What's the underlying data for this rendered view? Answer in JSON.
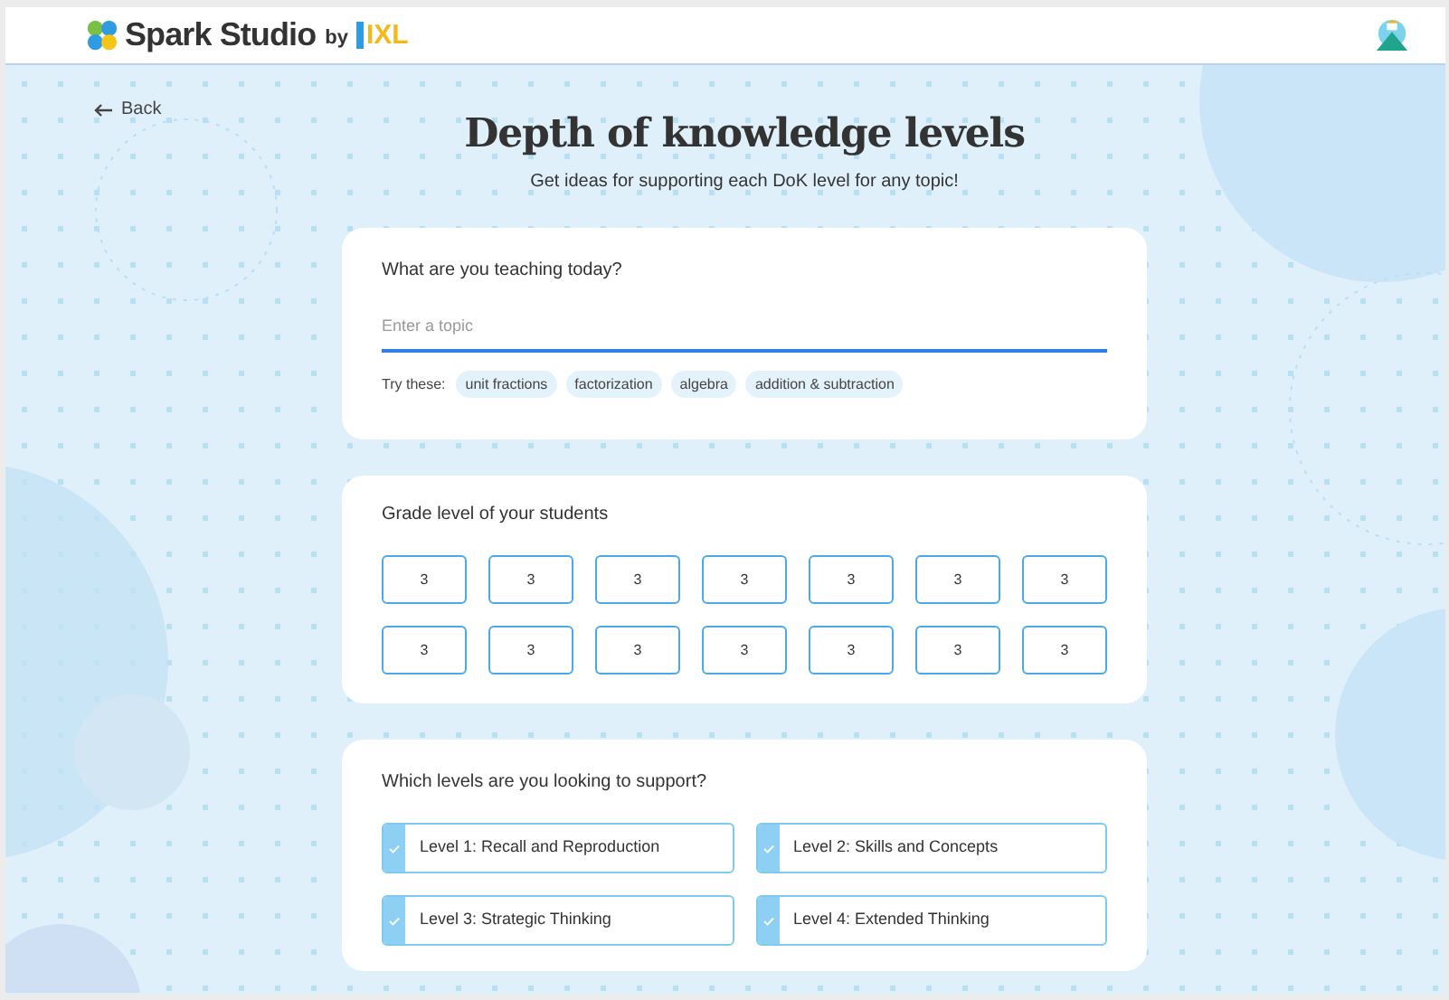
{
  "header": {
    "brand": "Spark Studio",
    "by": "by",
    "partner": "IXL"
  },
  "back": "Back",
  "title": "Depth of knowledge levels",
  "subtitle": "Get ideas for supporting each DoK level for any topic!",
  "topic": {
    "question": "What are you teaching today?",
    "placeholder": "Enter a topic",
    "try_label": "Try these:",
    "suggestions": [
      "unit fractions",
      "factorization",
      "algebra",
      "addition & subtraction"
    ]
  },
  "grade": {
    "question": "Grade level of your students",
    "options": [
      {
        "label": "3",
        "selected": false
      },
      {
        "label": "3",
        "selected": false
      },
      {
        "label": "3",
        "selected": false
      },
      {
        "label": "3",
        "selected": false
      },
      {
        "label": "3",
        "selected": false
      },
      {
        "label": "3",
        "selected": false
      },
      {
        "label": "3",
        "selected": false
      },
      {
        "label": "3",
        "selected": false
      },
      {
        "label": "3",
        "selected": false
      },
      {
        "label": "3",
        "selected": false
      },
      {
        "label": "3",
        "selected": false
      },
      {
        "label": "3",
        "selected": false
      },
      {
        "label": "3",
        "selected": false
      },
      {
        "label": "3",
        "selected": false
      }
    ]
  },
  "levels": {
    "question": "Which levels are you looking to support?",
    "options": [
      {
        "label": "Level 1: Recall and Reproduction",
        "checked": true
      },
      {
        "label": "Level 2: Skills and Concepts",
        "checked": true
      },
      {
        "label": "Level 3: Strategic Thinking",
        "checked": true
      },
      {
        "label": "Level 4: Extended Thinking",
        "checked": true
      }
    ]
  }
}
